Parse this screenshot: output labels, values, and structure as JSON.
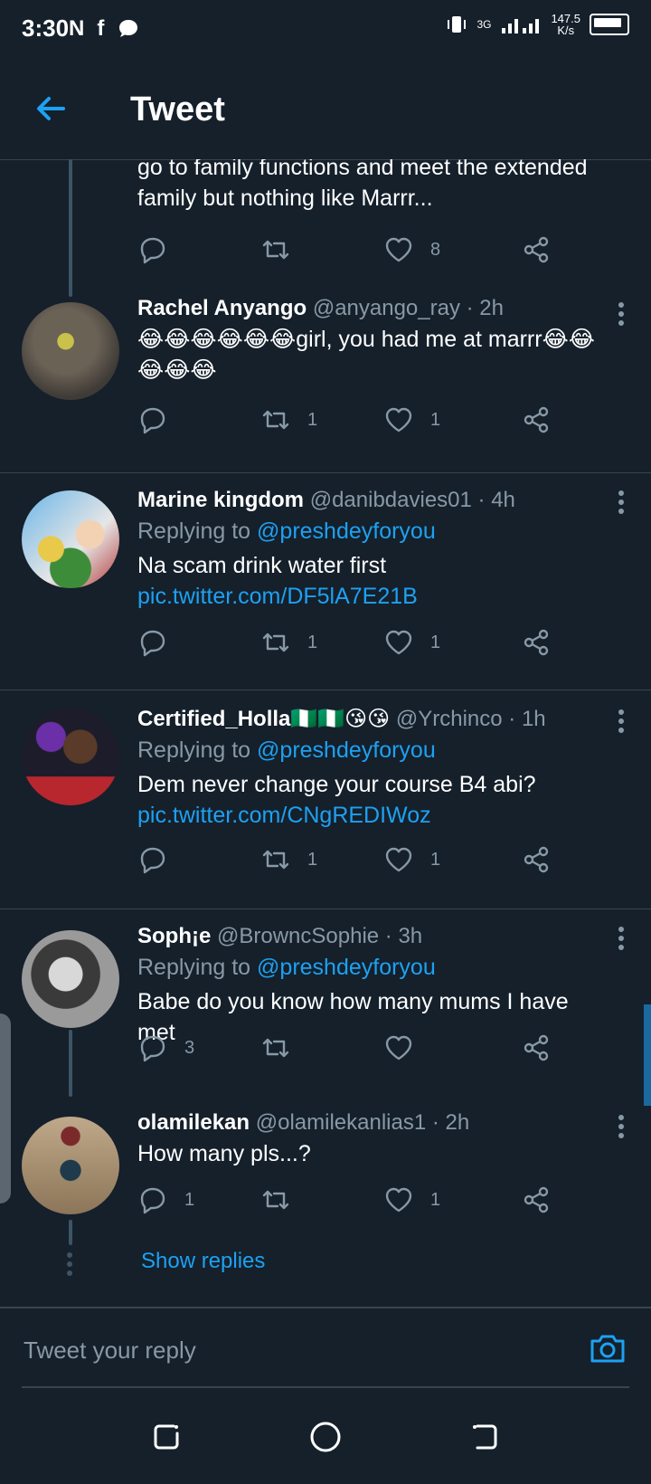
{
  "status_bar": {
    "time": "3:30",
    "left_icons": [
      "N",
      "f"
    ],
    "speed_value": "147.5",
    "speed_unit": "K/s",
    "network": "3G"
  },
  "header": {
    "title": "Tweet"
  },
  "tweets": [
    {
      "text": "go to family functions and meet the extended family but nothing like Marrr...",
      "likes": "8",
      "retweets": "",
      "replies": ""
    },
    {
      "name": "Rachel Anyango",
      "handle": "@anyango_ray",
      "time": "· 2h",
      "text": "😂😂😂😂😂😂girl, you had me at marrr😂😂😂😂😂",
      "replies": "",
      "retweets": "1",
      "likes": "1"
    },
    {
      "name": "Marine kingdom",
      "handle": "@danibdavies01",
      "time": "· 4h",
      "replying_label": "Replying to",
      "replying_handle": "@preshdeyforyou",
      "text": "Na scam drink water first",
      "link": "pic.twitter.com/DF5lA7E21B",
      "replies": "",
      "retweets": "1",
      "likes": "1"
    },
    {
      "name": "Certified_Holla🇳🇬🇳🇬😘😘",
      "handle": "@Yrchinco",
      "time": "· 1h",
      "replying_label": "Replying to",
      "replying_handle": "@preshdeyforyou",
      "text": "Dem never change your course B4 abi?",
      "link": "pic.twitter.com/CNgREDIWoz",
      "replies": "",
      "retweets": "1",
      "likes": "1"
    },
    {
      "name": "Soph¡e",
      "handle": "@BrowncSophie",
      "time": "· 3h",
      "replying_label": "Replying to",
      "replying_handle": "@preshdeyforyou",
      "text": "Babe do you know how many mums I have met",
      "replies": "3",
      "retweets": "",
      "likes": ""
    },
    {
      "name": "olamilekan",
      "handle": "@olamilekanlias1",
      "time": "· 2h",
      "text": "How many pls...?",
      "replies": "1",
      "retweets": "",
      "likes": "1"
    }
  ],
  "show_replies": "Show replies",
  "composer": {
    "placeholder": "Tweet your reply"
  },
  "colors": {
    "background": "#15202b",
    "accent": "#1da1f2",
    "secondary_text": "#8899a6",
    "divider": "#38444d"
  }
}
